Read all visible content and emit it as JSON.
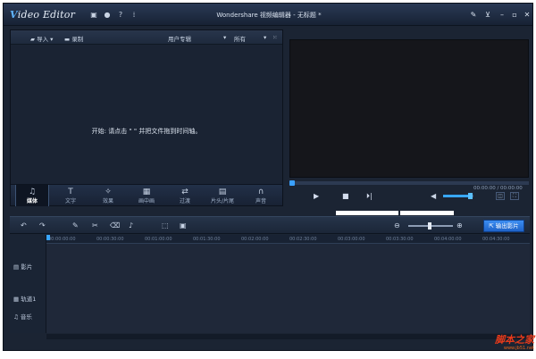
{
  "app": {
    "logo_v": "V",
    "logo_rest": "ideo Editor",
    "title": "Wondershare 视频编辑器 - 无标题 *",
    "icons": {
      "save": "save-icon",
      "chat": "chat-icon",
      "help": "help-icon",
      "settings": "wrench-icon",
      "cart": "cart-icon"
    },
    "min_label": "–",
    "max_label": "▫",
    "close_label": "✕"
  },
  "media": {
    "import_label": "导入",
    "record_label": "录制",
    "album_label": "用户专辑",
    "filter_label": "所有",
    "hint": "开始: 请点击 \"  \" 并把文件拖到时间轴。",
    "tabs": [
      {
        "label": "媒体",
        "icon": "♫"
      },
      {
        "label": "文字",
        "icon": "T"
      },
      {
        "label": "效果",
        "icon": "✧"
      },
      {
        "label": "画中画",
        "icon": "▦"
      },
      {
        "label": "过渡",
        "icon": "⇄"
      },
      {
        "label": "片头/片尾",
        "icon": "▤"
      },
      {
        "label": "声音",
        "icon": "∩"
      }
    ]
  },
  "preview": {
    "timecode": "00:00:00 / 00:00:00"
  },
  "timeline": {
    "export_label": "输出影片",
    "ruler": [
      "00:00:00:00",
      "00:00:30:00",
      "00:01:00:00",
      "00:01:30:00",
      "00:02:00:00",
      "00:02:30:00",
      "00:03:00:00",
      "00:03:30:00",
      "00:04:00:00",
      "00:04:30:00"
    ],
    "tracks": [
      {
        "label": "影片"
      },
      {
        "label": "轨道1"
      },
      {
        "label": "音乐"
      }
    ]
  },
  "watermark": {
    "main": "脚本之家",
    "sub": "www.jb51.net"
  }
}
